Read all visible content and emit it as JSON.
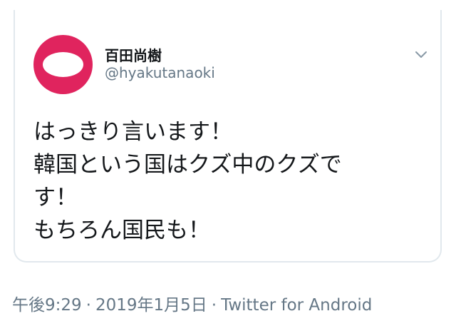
{
  "tweet": {
    "author": {
      "display_name": "百田尚樹",
      "handle": "@hyakutanaoki",
      "avatar_icon": "avatar-icon",
      "accent_color": "#e0245e"
    },
    "menu_icon": "chevron-down-icon",
    "text_lines": [
      "はっきり言います！",
      "韓国という国はクズ中のクズで",
      "す！",
      "もちろん国民も！"
    ],
    "meta": {
      "time": "午後9:29",
      "separator": "·",
      "date": "2019年1月5日",
      "source": "Twitter for Android"
    }
  }
}
